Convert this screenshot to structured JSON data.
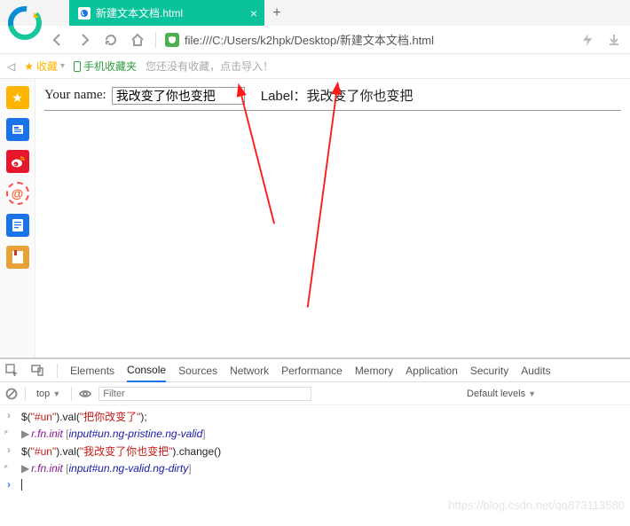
{
  "browser": {
    "tab_title": "新建文本文档.html",
    "new_tab": "+",
    "url": "file:///C:/Users/k2hpk/Desktop/新建文本文档.html"
  },
  "bookmarks": {
    "favorites": "收藏",
    "phone_fav": "手机收藏夹",
    "hint": "您还没有收藏，点击导入！"
  },
  "page": {
    "name_label": "Your name:",
    "name_value": "我改变了你也变把",
    "out_label_prefix": "Label：",
    "out_label_value": "我改变了你也变把"
  },
  "devtools": {
    "tabs": {
      "elements": "Elements",
      "console": "Console",
      "sources": "Sources",
      "network": "Network",
      "performance": "Performance",
      "memory": "Memory",
      "application": "Application",
      "security": "Security",
      "audits": "Audits"
    },
    "toolbar": {
      "context": "top",
      "filter_placeholder": "Filter",
      "levels": "Default levels"
    },
    "console_lines": {
      "l1_a": "$(",
      "l1_b": "\"#un\"",
      "l1_c": ").val(",
      "l1_d": "\"把你改变了\"",
      "l1_e": ");",
      "l2_a": "r.fn.init",
      "l2_b": " [",
      "l2_c": "input#un.ng-pristine.ng-valid",
      "l2_d": "]",
      "l3_a": "$(",
      "l3_b": "\"#un\"",
      "l3_c": ").val(",
      "l3_d": "\"我改变了你也变把\"",
      "l3_e": ").change()",
      "l4_a": "r.fn.init",
      "l4_b": " [",
      "l4_c": "input#un.ng-valid.ng-dirty",
      "l4_d": "]"
    }
  },
  "watermark": "https://blog.csdn.net/qq873113580"
}
